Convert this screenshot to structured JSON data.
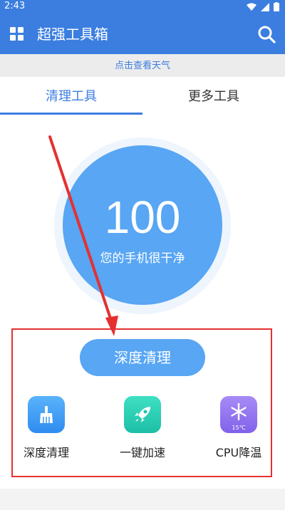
{
  "status_bar": {
    "time": "2:43"
  },
  "app_bar": {
    "title": "超强工具箱"
  },
  "weather": {
    "text": "点击查看天气"
  },
  "tabs": [
    {
      "label": "清理工具",
      "active": true
    },
    {
      "label": "更多工具",
      "active": false
    }
  ],
  "gauge": {
    "score": "100",
    "message": "您的手机很干净"
  },
  "main_action": {
    "label": "深度清理"
  },
  "tools": [
    {
      "label": "深度清理",
      "icon": "broom-icon"
    },
    {
      "label": "一键加速",
      "icon": "rocket-icon"
    },
    {
      "label": "CPU降温",
      "icon": "snowflake-icon",
      "badge": "15℃"
    }
  ],
  "colors": {
    "primary": "#3b7ee0",
    "gauge": "#58a6f4",
    "highlight": "#e53030"
  }
}
